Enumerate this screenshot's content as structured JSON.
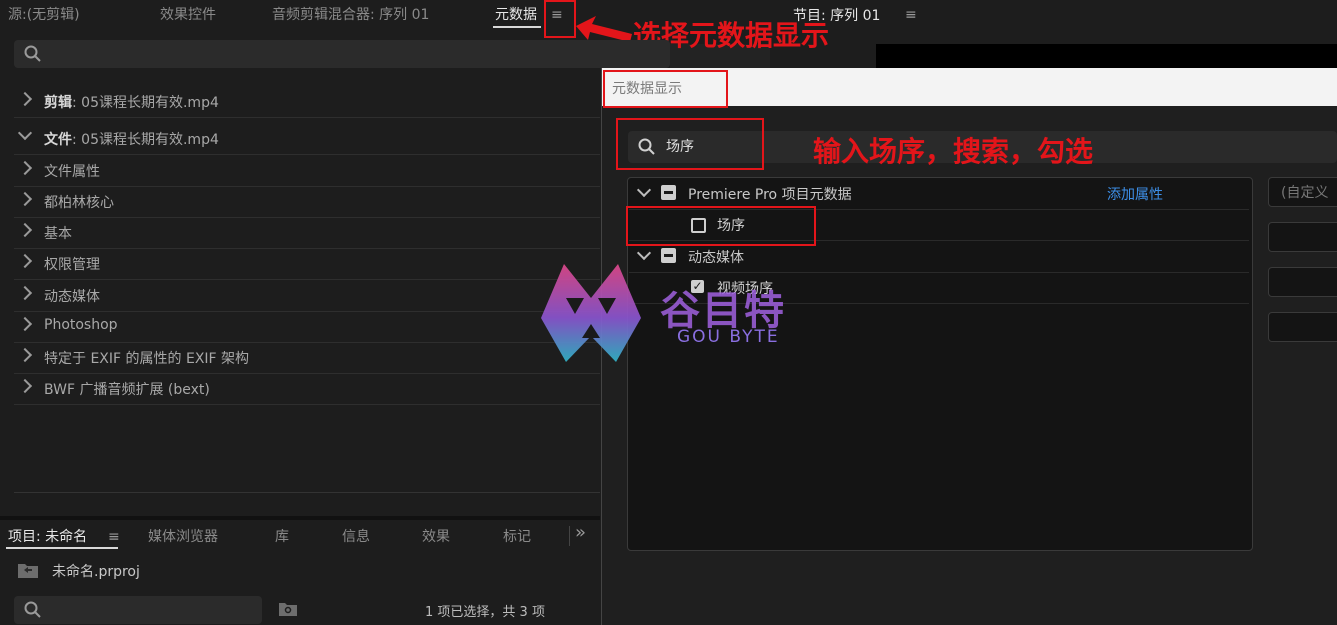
{
  "top_tabs": {
    "source": "源:(无剪辑)",
    "effect_controls": "效果控件",
    "audio_mixer": "音频剪辑混合器: 序列 01",
    "metadata": "元数据",
    "program_prefix": "节目:",
    "program": "序列 01"
  },
  "menu_icon": "≡",
  "annotations": {
    "select_display": "选择元数据显示",
    "search_hint": "输入场序，搜索，勾选"
  },
  "metadata_panel": {
    "sections": [
      {
        "prefix": "剪辑",
        "value": ": 05课程长期有效.mp4",
        "expanded": false
      },
      {
        "prefix": "文件",
        "value": ": 05课程长期有效.mp4",
        "expanded": true
      },
      {
        "label": "文件属性",
        "expanded": false
      },
      {
        "label": "都柏林核心",
        "expanded": false
      },
      {
        "label": "基本",
        "expanded": false
      },
      {
        "label": "权限管理",
        "expanded": false
      },
      {
        "label": "动态媒体",
        "expanded": false
      },
      {
        "label": "Photoshop",
        "expanded": false
      },
      {
        "label": "特定于 EXIF 的属性的 EXIF 架构",
        "expanded": false
      },
      {
        "label": "BWF 广播音频扩展 (bext)",
        "expanded": false
      }
    ]
  },
  "dialog": {
    "title": "元数据显示",
    "search_value": "场序",
    "group1": {
      "label": "Premiere Pro 项目元数据",
      "add_property": "添加属性"
    },
    "item1": "场序",
    "group2": {
      "label": "动态媒体"
    },
    "item2": "视频场序",
    "right_custom": "(自定义"
  },
  "watermark": {
    "cn": "谷目特",
    "en": "GOU BYTE"
  },
  "project_panel": {
    "tabs": [
      "项目: 未命名",
      "媒体浏览器",
      "库",
      "信息",
      "效果",
      "标记"
    ],
    "more": "»",
    "file_name": "未命名.prproj",
    "status": "1 项已选择，共 3 项"
  },
  "colors": {
    "accent_red": "#e3151a",
    "link_blue": "#3d8ee6"
  }
}
